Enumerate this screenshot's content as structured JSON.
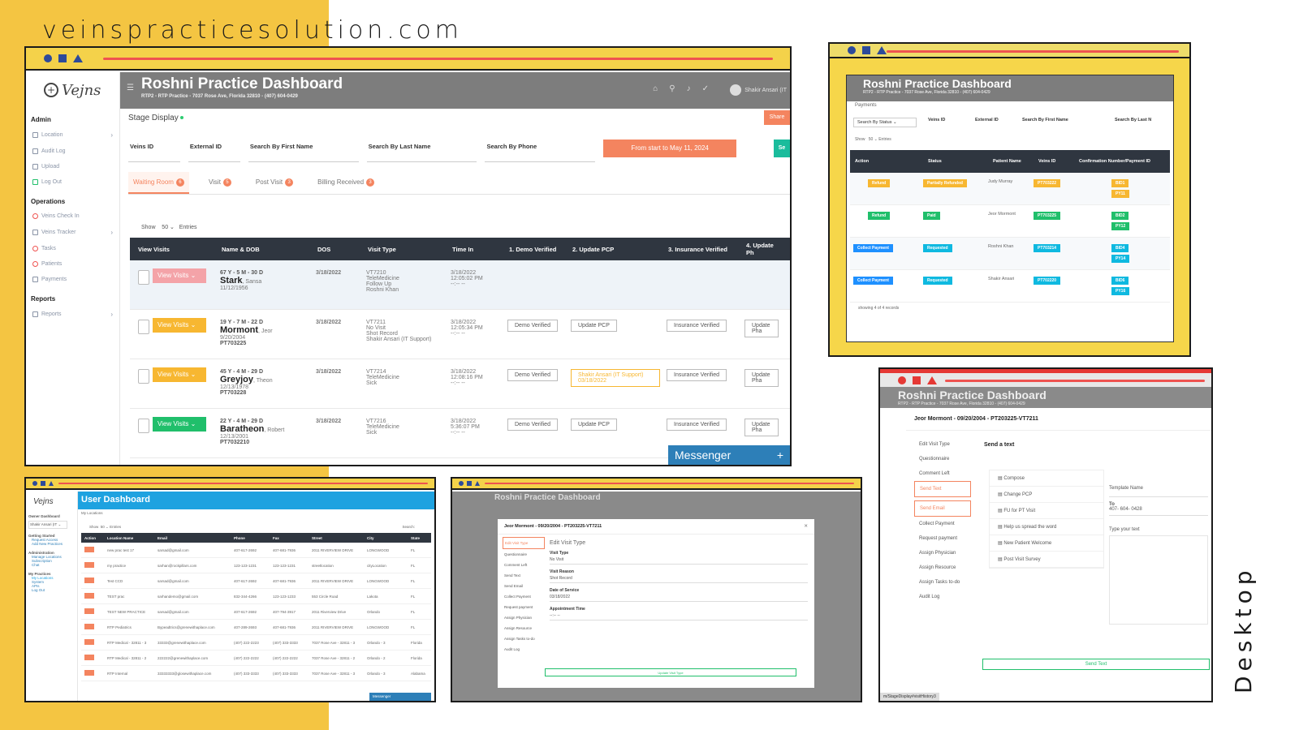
{
  "site": {
    "url": "veinspracticesolution.com",
    "tag": "Desktop"
  },
  "main": {
    "logo": "Vejns",
    "title": "Roshni Practice Dashboard",
    "subtitle": "RTP2 - RTP Practice - 7037 Rose Ave, Florida 32810 - (407) 604-0429",
    "user": "Shakir Ansari (IT",
    "stage": "Stage Display",
    "share": "Share",
    "sidebar": {
      "admin": "Admin",
      "items_admin": [
        "Location",
        "Audit Log",
        "Upload",
        "Log Out"
      ],
      "operations": "Operations",
      "items_ops": [
        "Veins Check In",
        "Veins Tracker",
        "Tasks",
        "Patients",
        "Payments"
      ],
      "reports": "Reports",
      "items_reports": [
        "Reports"
      ]
    },
    "filters": [
      "Veins ID",
      "External ID",
      "Search By First Name",
      "Search By Last Name",
      "Search By Phone"
    ],
    "date_range": "From start to May 11, 2024",
    "go": "Se",
    "tabs": [
      {
        "label": "Waiting Room",
        "count": "6"
      },
      {
        "label": "Visit",
        "count": "5"
      },
      {
        "label": "Post Visit",
        "count": "3"
      },
      {
        "label": "Billing Received",
        "count": "3"
      }
    ],
    "show": "Show",
    "show_val": "50",
    "entries": "Entries",
    "columns": [
      "View Visits",
      "Name & DOB",
      "DOS",
      "Visit Type",
      "Time In",
      "1. Demo Verified",
      "2. Update PCP",
      "3. Insurance Verified",
      "4. Update Ph"
    ],
    "view_visits_label": "View Visits",
    "rows": [
      {
        "age": "67 Y - 5 M - 30 D",
        "last": "Stark",
        "first": "Sansa",
        "dob": "11/12/1956",
        "pt": "",
        "dos": "3/18/2022",
        "visit": [
          "VT7210",
          "TeleMedicine",
          "Follow Up",
          "Roshni Khan"
        ],
        "date": "3/18/2022",
        "time": "12:05:02 PM",
        "demo": "",
        "pcp": "",
        "ins": "",
        "ph": ""
      },
      {
        "age": "19 Y - 7 M - 22 D",
        "last": "Mormont",
        "first": "Jeor",
        "dob": "9/20/2004",
        "pt": "PT703225",
        "dos": "3/18/2022",
        "visit": [
          "VT7211",
          "No Visit",
          "Shot Record",
          "Shakir Ansari (IT Support)"
        ],
        "date": "3/18/2022",
        "time": "12:05:34 PM",
        "demo": "Demo Verified",
        "pcp": "Update PCP",
        "ins": "Insurance Verified",
        "ph": "Update Pha"
      },
      {
        "age": "45 Y - 4 M - 29 D",
        "last": "Greyjoy",
        "first": "Theon",
        "dob": "12/13/1978",
        "pt": "PT703228",
        "dos": "3/18/2022",
        "visit": [
          "VT7214",
          "TeleMedicine",
          "Sick"
        ],
        "date": "3/18/2022",
        "time": "12:08:16 PM",
        "demo": "Demo Verified",
        "pcp": "Shakir Ansari (IT Support) 03/18/2022",
        "ins": "Insurance Verified",
        "ph": "Update Pha"
      },
      {
        "age": "22 Y - 4 M - 29 D",
        "last": "Baratheon",
        "first": "Robert",
        "dob": "12/13/2001",
        "pt": "PT7032210",
        "dos": "3/18/2022",
        "visit": [
          "VT7216",
          "TeleMedicine",
          "Sick"
        ],
        "date": "3/18/2022",
        "time": "5:36:07 PM",
        "demo": "Demo Verified",
        "pcp": "Update PCP",
        "ins": "Insurance Verified",
        "ph": "Update Pha"
      }
    ],
    "time_placeholder": "--:-- --",
    "messenger": "Messenger"
  },
  "payments": {
    "title": "Roshni Practice Dashboard",
    "subtitle": "RTP2 - RTP Practice - 7037 Rose Ave, Florida 32810 - (407) 604-0429",
    "section": "Payments",
    "status_filter": "Search By Status",
    "filters": [
      "Veins ID",
      "External ID",
      "Search By First Name",
      "Search By Last N"
    ],
    "show": "Show",
    "show_val": "50",
    "entries": "Entries",
    "columns": [
      "Action",
      "Status",
      "Patient Name",
      "Veins ID",
      "Confirmation Number/Payment ID"
    ],
    "rows": [
      {
        "action": "Refund",
        "status": "Partially Refunded",
        "name": "Judy Murray",
        "id": "PT703222",
        "c1": "BID1",
        "c2": "PY11"
      },
      {
        "action": "Refund",
        "status": "Paid",
        "name": "Jeor Mormont",
        "id": "PT703225",
        "c1": "BID2",
        "c2": "PY12"
      },
      {
        "action": "Collect Payment",
        "status": "Requested",
        "name": "Roshni Khan",
        "id": "PT703214",
        "c1": "BID4",
        "c2": "PY14"
      },
      {
        "action": "Collect Payment",
        "status": "Requested",
        "name": "Shakir Ansari",
        "id": "PT702220",
        "c1": "BID6",
        "c2": "PY16"
      }
    ],
    "footer": "showing 4 of 4 records"
  },
  "userdash": {
    "title": "User Dashboard",
    "sub": "My Locations",
    "side": [
      "Owner Dashboard",
      "Getting Started",
      "Request Access",
      "Add New Practices",
      "Administration",
      "Manage Locations",
      "Subscription",
      "Chat",
      "My Practices",
      "My Locations",
      "System",
      "APIs",
      "Log Out"
    ],
    "show": "Show",
    "show_val": "50",
    "entries": "Entries",
    "search": "Search:",
    "columns": [
      "Action",
      "Location Name",
      "Email",
      "Phone",
      "Fax",
      "Street",
      "City",
      "State"
    ],
    "rows": [
      [
        "new prac test 17",
        "sarsad@gmail.com",
        "407-617-2692",
        "407-681-7936",
        "2011 RIVERVIEW DRIVE",
        "LONGWOOD",
        "FL"
      ],
      [
        "my practice",
        "sarhan@rockpillars.com",
        "123-123-1231",
        "123-123-1231",
        "streetlocation",
        "cityLocation",
        "FL"
      ],
      [
        "Test CCD",
        "sarsad@gmail.com",
        "407-617-2692",
        "407-681-7936",
        "2011 RIVERVIEW DRIVE",
        "LONGWOOD",
        "FL"
      ],
      [
        "TEST prac",
        "sarhandemo@gmail.com",
        "832-344-4266",
        "123-123-1233",
        "553 Circle Road",
        "Lakota",
        "FL"
      ],
      [
        "TEST NEW PRACTICE",
        "sarsad@gmail.com",
        "407-617-2692",
        "407-794-3917",
        "2011 Riverview Drive",
        "Orlando",
        "FL"
      ],
      [
        "RTP Pediatrics",
        "Bypeadtrics@grenewithaplace.com",
        "407-289-2693",
        "407-681-7936",
        "2011 RIVERVIEW DRIVE",
        "LONGWOOD",
        "FL"
      ],
      [
        "RTP Medical - 32811 - 3",
        "33333@grenewithaplace.com",
        "(407) 222-2223",
        "(407) 333-3333",
        "7037 Rose Ave - 32811 - 3",
        "Orlando - 3",
        "Florida"
      ],
      [
        "RTP Medical - 32811 - 2",
        "222222@grenewithaplace.com",
        "(407) 222-2222",
        "(407) 222-2222",
        "7037 Rose Ave - 32811 - 2",
        "Orlando - 2",
        "Florida"
      ],
      [
        "RTP Internal",
        "33333333@glosewithaplace.com",
        "(407) 333-3333",
        "(407) 333-3333",
        "7037 Rose Ave - 32811 - 3",
        "Orlando - 3",
        "Alabama"
      ]
    ],
    "messenger": "Messenger"
  },
  "editvisit": {
    "title": "Jeor Mormont - 09/20/2004 - PT203225-VT7211",
    "heading": "Edit Visit Type",
    "menu": [
      "Edit Visit Type",
      "Questionnaire",
      "Comment Left",
      "Send Text",
      "Send Email",
      "Collect Payment",
      "Request payment",
      "Assign Physician",
      "Assign Resource",
      "Assign Tasks to-do",
      "Audit Log"
    ],
    "fields": [
      {
        "label": "Visit Type",
        "value": "No Visit"
      },
      {
        "label": "Visit Reason",
        "value": "Shot Record"
      },
      {
        "label": "Date of Service",
        "value": "03/18/2022"
      },
      {
        "label": "Appointment Time",
        "value": "--:-- --"
      }
    ],
    "button": "Update Visit Type"
  },
  "sendtext": {
    "bg_title": "Roshni Practice Dashboard",
    "bg_sub": "RTP2 - RTP Practice - 7037 Rose Ave, Florida 32810 - (407) 604-0429",
    "title": "Jeor Mormont - 09/20/2004 - PT203225-VT7211",
    "heading": "Send a text",
    "menu": [
      "Edit Visit Type",
      "Questionnaire",
      "Comment Left",
      "Send Text",
      "Send Email",
      "Collect Payment",
      "Request payment",
      "Assign Physician",
      "Assign Resource",
      "Assign Tasks to-do",
      "Audit Log"
    ],
    "templates": [
      "Compose",
      "Change PCP",
      "FU for PT Visit",
      "Help us spread the word",
      "New Patient Welcome",
      "Post Visit Survey"
    ],
    "template_name": "Template Name",
    "to_label": "To",
    "to_value": "407- 604- 0428",
    "text_label": "Type your text",
    "button": "Send Text",
    "url": "m/StageDisplay#visitHistory3"
  }
}
